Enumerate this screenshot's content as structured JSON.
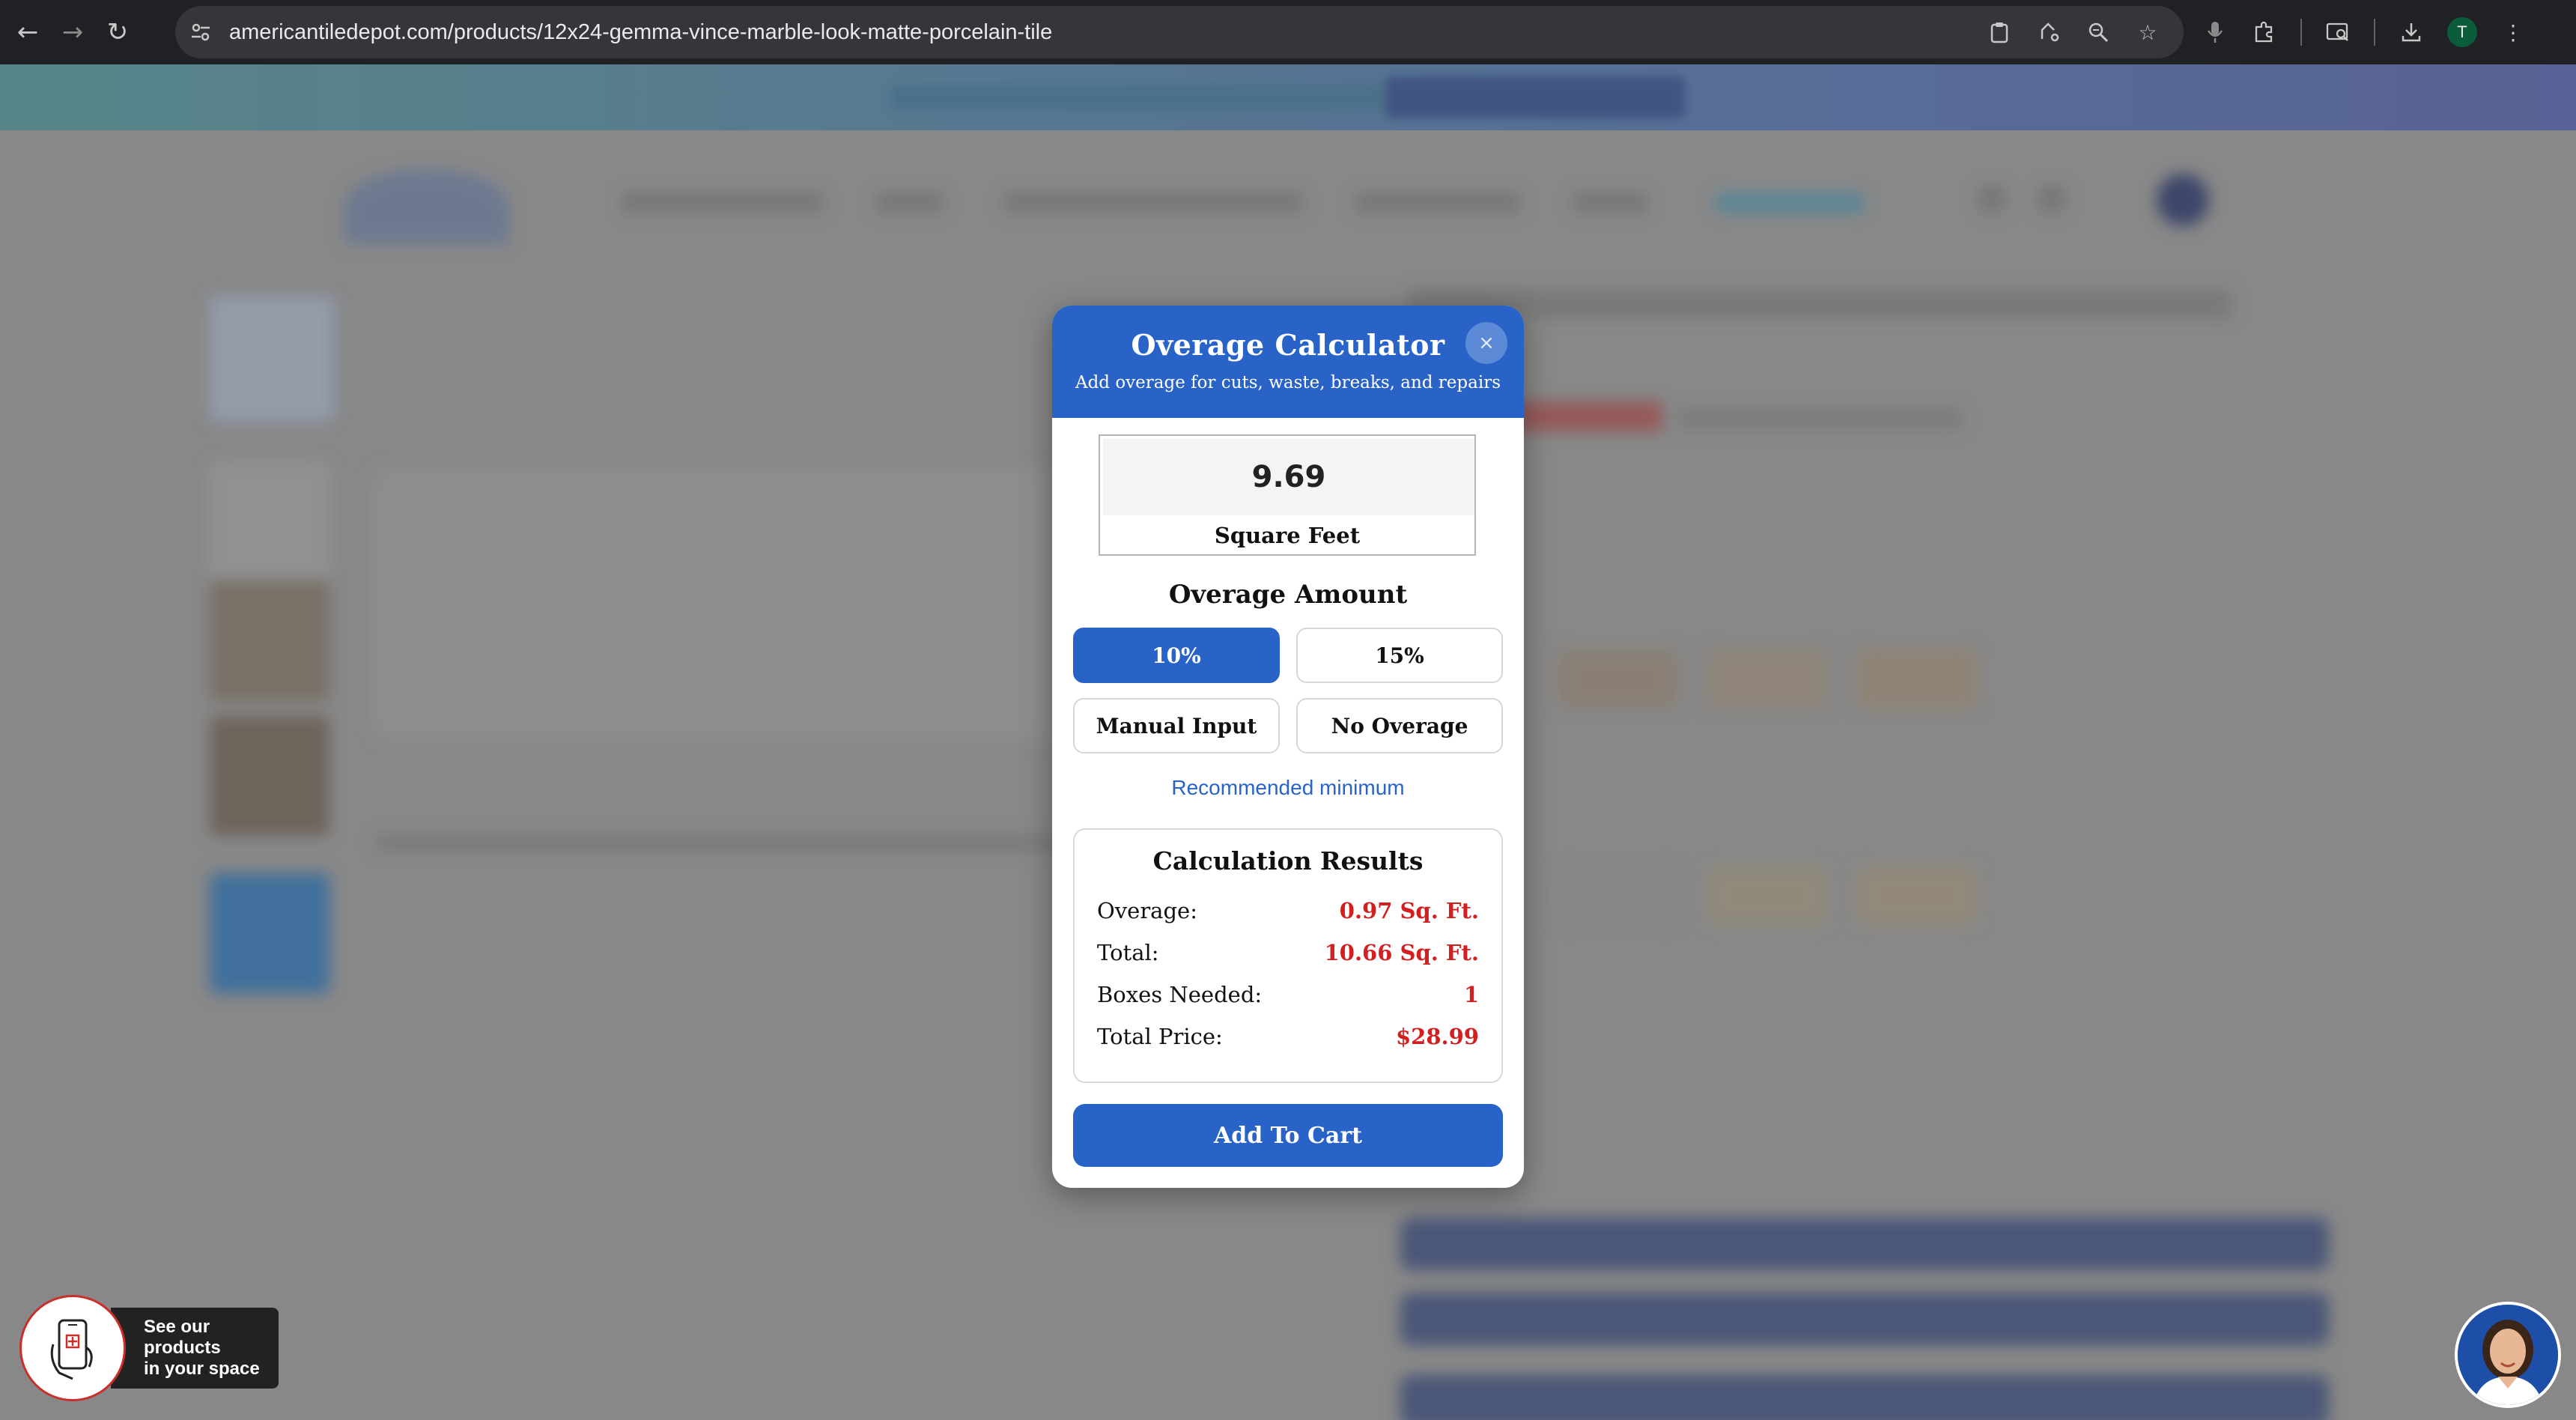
{
  "browser": {
    "url": "americantiledepot.com/products/12x24-gemma-vince-marble-look-matte-porcelain-tile",
    "profile_initial": "T",
    "icons": [
      "back-icon",
      "forward-icon",
      "reload-icon",
      "site-info-icon",
      "clipboard-icon",
      "share-icon",
      "zoom-icon",
      "star-icon",
      "mic-icon",
      "extensions-icon",
      "tab-search-icon",
      "download-icon",
      "menu-icon"
    ]
  },
  "modal": {
    "title": "Overage Calculator",
    "subtitle": "Add overage for cuts, waste, breaks, and repairs",
    "close_label": "×",
    "area_value": "9.69",
    "area_unit": "Square Feet",
    "overage_section_title": "Overage Amount",
    "options": [
      {
        "label": "10%",
        "active": true
      },
      {
        "label": "15%",
        "active": false
      },
      {
        "label": "Manual Input",
        "active": false
      },
      {
        "label": "No Overage",
        "active": false
      }
    ],
    "recommended_text": "Recommended minimum",
    "results": {
      "title": "Calculation Results",
      "rows": [
        {
          "label": "Overage:",
          "value": "0.97 Sq. Ft."
        },
        {
          "label": "Total:",
          "value": "10.66 Sq. Ft."
        },
        {
          "label": "Boxes Needed:",
          "value": "1"
        },
        {
          "label": "Total Price:",
          "value": "$28.99"
        }
      ]
    },
    "cart_button": "Add To Cart"
  },
  "widgets": {
    "ar_text_line1": "See our products",
    "ar_text_line2": "in your space"
  },
  "colors": {
    "accent": "#2a63c7",
    "price_red": "#d21f1f",
    "chrome_bg": "#202124"
  }
}
